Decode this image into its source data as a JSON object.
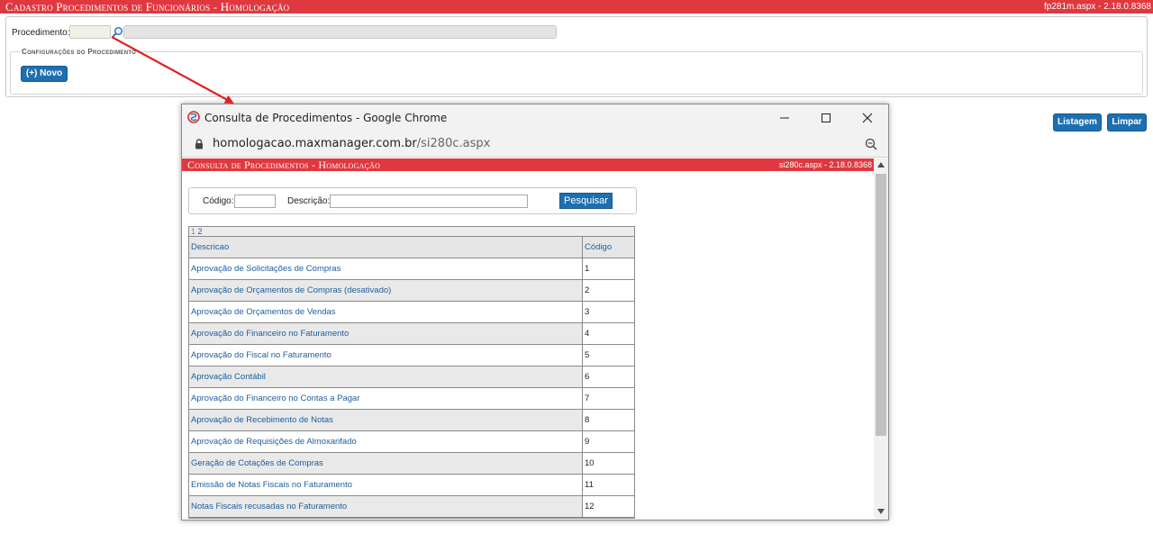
{
  "app": {
    "title": "Cadastro Procedimentos de Funcionários  - Homologação",
    "version": "fp281m.aspx - 2.18.0.8368",
    "procedimento_label": "Procedimento:",
    "config_legend": "Configurações do Procedimento",
    "novo_label": "(+) Novo",
    "listagem_label": "Listagem",
    "limpar_label": "Limpar"
  },
  "popup": {
    "window_title": "Consulta de Procedimentos - Google Chrome",
    "url_host": "homologacao.maxmanager.com.br",
    "url_path": "/si280c.aspx",
    "header_title": "Consulta de Procedimentos  - Homologação",
    "header_version": "si280c.aspx - 2.18.0.8368",
    "codigo_label": "Código:",
    "descricao_label": "Descrição:",
    "pesquisar_label": "Pesquisar",
    "pager": {
      "current": "1",
      "next": "2"
    },
    "columns": {
      "descricao": "Descricao",
      "codigo": "Código"
    },
    "rows": [
      {
        "descricao": "Aprovação de Solicitações de Compras",
        "codigo": "1"
      },
      {
        "descricao": "Aprovação de Orçamentos de Compras (desativado)",
        "codigo": "2"
      },
      {
        "descricao": "Aprovação de Orçamentos de Vendas",
        "codigo": "3"
      },
      {
        "descricao": "Aprovação do Financeiro no Faturamento",
        "codigo": "4"
      },
      {
        "descricao": "Aprovação do Fiscal no Faturamento",
        "codigo": "5"
      },
      {
        "descricao": "Aprovação Contábil",
        "codigo": "6"
      },
      {
        "descricao": "Aprovação do Financeiro no Contas a Pagar",
        "codigo": "7"
      },
      {
        "descricao": "Aprovação de Recebimento de Notas",
        "codigo": "8"
      },
      {
        "descricao": "Aprovação de Requisições de Almoxarifado",
        "codigo": "9"
      },
      {
        "descricao": "Geração de Cotações de Compras",
        "codigo": "10"
      },
      {
        "descricao": "Emissão de Notas Fiscais no Faturamento",
        "codigo": "11"
      },
      {
        "descricao": "Notas Fiscais recusadas no Faturamento",
        "codigo": "12"
      }
    ]
  },
  "colors": {
    "header_red": "#e0383f",
    "button_blue": "#1e6fb0",
    "link_blue": "#1e5fa0",
    "arrow_red": "#e02020"
  }
}
